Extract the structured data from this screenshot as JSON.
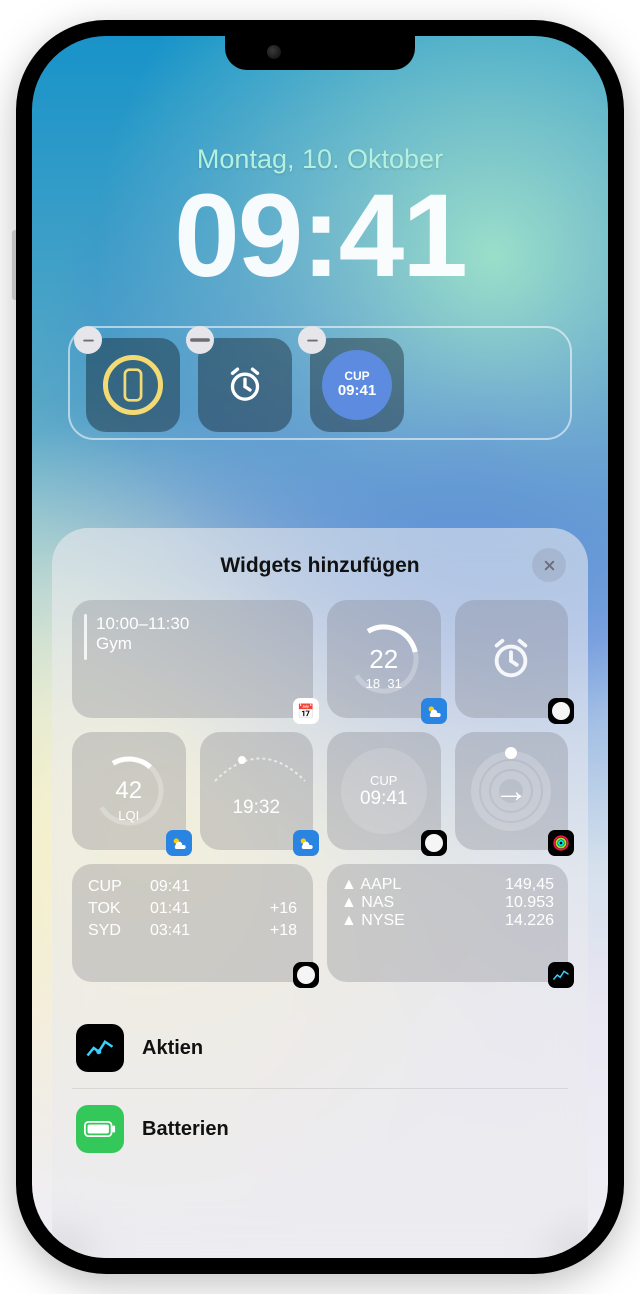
{
  "lockscreen": {
    "date": "Montag, 10. Oktober",
    "time": "09:41"
  },
  "shelf": {
    "world": {
      "label": "CUP",
      "time": "09:41"
    }
  },
  "sheet": {
    "title": "Widgets hinzufügen",
    "calendar": {
      "time": "10:00–11:30",
      "event": "Gym"
    },
    "temp": {
      "value": "22",
      "lo": "18",
      "hi": "31"
    },
    "aqi": {
      "value": "42",
      "label": "LQI"
    },
    "sun": {
      "time": "19:32"
    },
    "world": {
      "label": "CUP",
      "time": "09:41"
    },
    "clocklist": [
      {
        "city": "CUP",
        "time": "09:41",
        "off": ""
      },
      {
        "city": "TOK",
        "time": "01:41",
        "off": "+16"
      },
      {
        "city": "SYD",
        "time": "03:41",
        "off": "+18"
      }
    ],
    "stocks": [
      {
        "sym": "AAPL",
        "val": "149,45"
      },
      {
        "sym": "NAS",
        "val": "10.953"
      },
      {
        "sym": "NYSE",
        "val": "14.226"
      }
    ],
    "apps": [
      {
        "id": "stocks",
        "name": "Aktien"
      },
      {
        "id": "battery",
        "name": "Batterien"
      }
    ]
  }
}
